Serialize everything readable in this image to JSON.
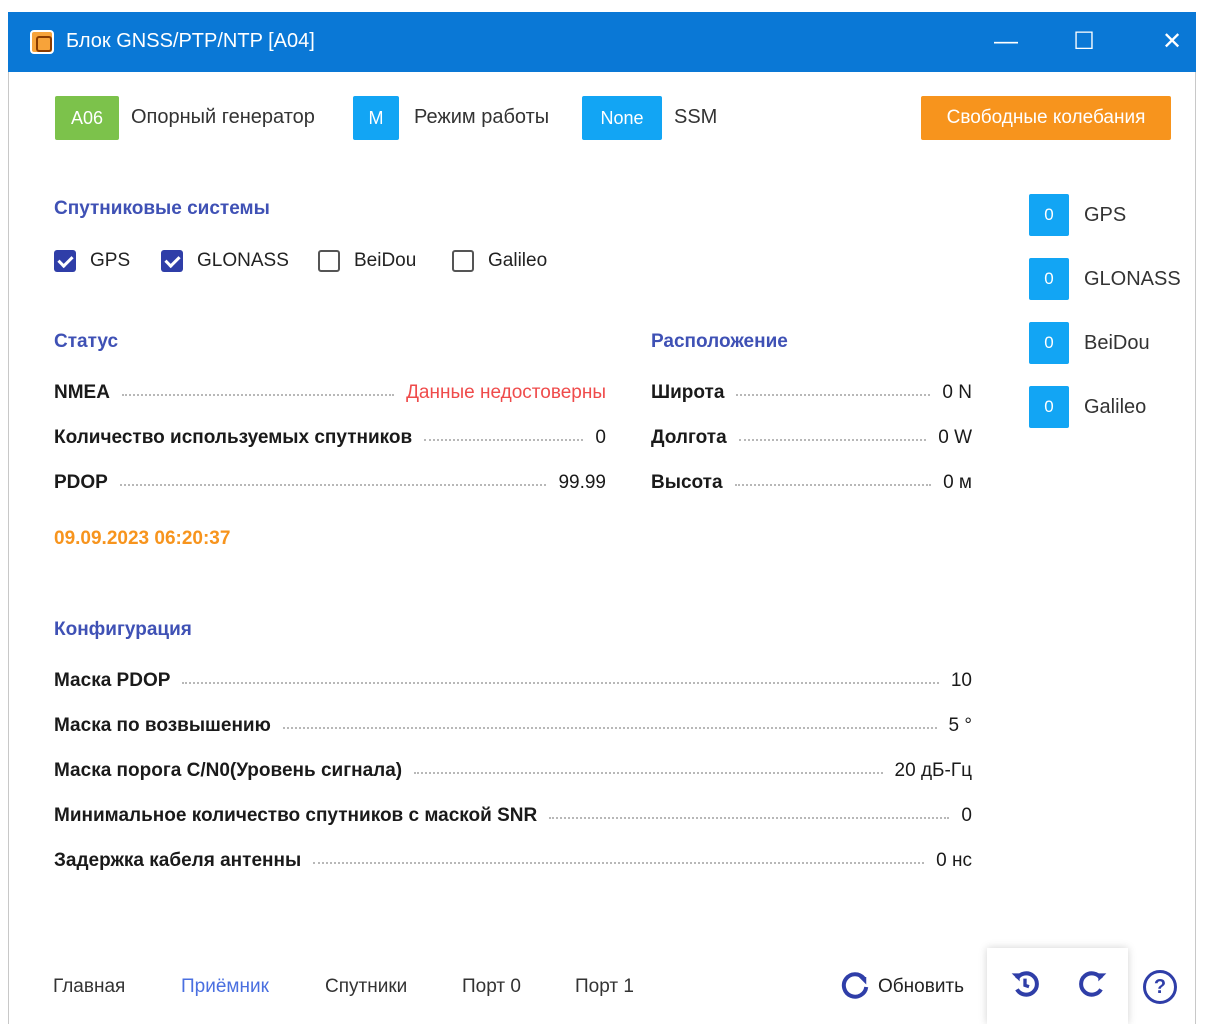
{
  "window": {
    "title": "Блок GNSS/PTP/NTP [A04]",
    "controls": {
      "minimize": "—",
      "maximize": "☐",
      "close": "✕"
    }
  },
  "top": {
    "generator": {
      "tag": "A06",
      "label": "Опорный генератор",
      "color": "#7cc24b"
    },
    "mode": {
      "tag": "M",
      "label": "Режим работы",
      "color": "#12a5f4"
    },
    "ssm": {
      "tag": "None",
      "label": "SSM",
      "color": "#12a5f4"
    },
    "free_button": "Свободные колебания"
  },
  "satellite_systems": {
    "title": "Спутниковые системы",
    "items": [
      {
        "label": "GPS",
        "checked": true
      },
      {
        "label": "GLONASS",
        "checked": true
      },
      {
        "label": "BeiDou",
        "checked": false
      },
      {
        "label": "Galileo",
        "checked": false
      }
    ]
  },
  "status": {
    "title": "Статус",
    "rows": [
      {
        "key": "NMEA",
        "value": "Данные недостоверны"
      },
      {
        "key": "Количество используемых спутников",
        "value": "0"
      },
      {
        "key": "PDOP",
        "value": "99.99"
      }
    ],
    "datetime": "09.09.2023 06:20:37"
  },
  "location": {
    "title": "Расположение",
    "rows": [
      {
        "key": "Широта",
        "value": "0 N"
      },
      {
        "key": "Долгота",
        "value": "0 W"
      },
      {
        "key": "Высота",
        "value": "0 м"
      }
    ]
  },
  "sat_counts": [
    {
      "count": "0",
      "label": "GPS"
    },
    {
      "count": "0",
      "label": "GLONASS"
    },
    {
      "count": "0",
      "label": "BeiDou"
    },
    {
      "count": "0",
      "label": "Galileo"
    }
  ],
  "config": {
    "title": "Конфигурация",
    "rows": [
      {
        "key": "Маска PDOP",
        "value": "10"
      },
      {
        "key": "Маска по возвышению",
        "value": "5 °"
      },
      {
        "key": "Маска порога C/N0(Уровень сигнала)",
        "value": "20 дБ-Гц"
      },
      {
        "key": "Минимальное количество спутников с маской SNR",
        "value": "0"
      },
      {
        "key": "Задержка кабеля антенны",
        "value": "0 нс"
      }
    ]
  },
  "nav": {
    "items": [
      "Главная",
      "Приёмник",
      "Спутники",
      "Порт 0",
      "Порт 1"
    ],
    "active": "Приёмник"
  },
  "toolbar": {
    "refresh_label": "Обновить",
    "refresh_icon": "refresh-icon",
    "undo_icon": "undo-icon",
    "redo_icon": "redo-icon",
    "help_icon": "help-icon"
  }
}
